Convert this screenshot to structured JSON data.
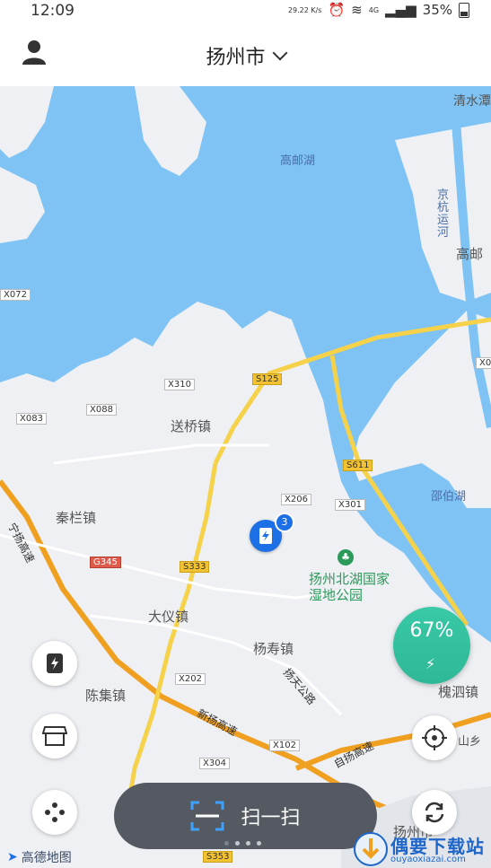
{
  "status_bar": {
    "time": "12:09",
    "net_speed": "29.22 K/s",
    "signal": "4G",
    "battery": "35%"
  },
  "header": {
    "city": "扬州市"
  },
  "map": {
    "places": {
      "gaoyou_lake": "高邮湖",
      "qingshui": "清水潭",
      "jinghang_canal": "京杭运河",
      "gaoyou": "高邮",
      "songqiao": "送桥镇",
      "qinlan": "秦栏镇",
      "dayi": "大仪镇",
      "yangshou": "杨寿镇",
      "chenji": "陈集镇",
      "huaisi": "槐泗镇",
      "shaobo_lake": "邵伯湖",
      "park": "扬州北湖国家湿地公园",
      "yangzhou_city": "扬州市",
      "shanxiang": "山乡"
    },
    "roads": {
      "x072": "X072",
      "x083": "X083",
      "x088": "X088",
      "x310": "X310",
      "s125": "S125",
      "s611": "S611",
      "x206": "X206",
      "x301": "X301",
      "g345": "G345",
      "s333": "S333",
      "x202": "X202",
      "x102": "X102",
      "x304": "X304",
      "s353": "S353",
      "x0": "X0",
      "xinyang_expressway": "新扬高速",
      "ningyang_expressway": "宁扬高速",
      "ziyang_expressway": "自扬高速",
      "yangtian_road": "扬天公路"
    },
    "station_count": "3",
    "battery_level": "67%"
  },
  "scan_button": {
    "label": "扫一扫"
  },
  "map_provider": "高德地图",
  "watermark": {
    "title": "偶要下载站",
    "url": "ouyaoxiazai.com"
  },
  "colors": {
    "water": "#7ec3f3",
    "land": "#eef0f3",
    "highway": "#f0a020",
    "road": "#f5d24a",
    "accent": "#1d6fe5",
    "gauge": "#38c9a6"
  }
}
